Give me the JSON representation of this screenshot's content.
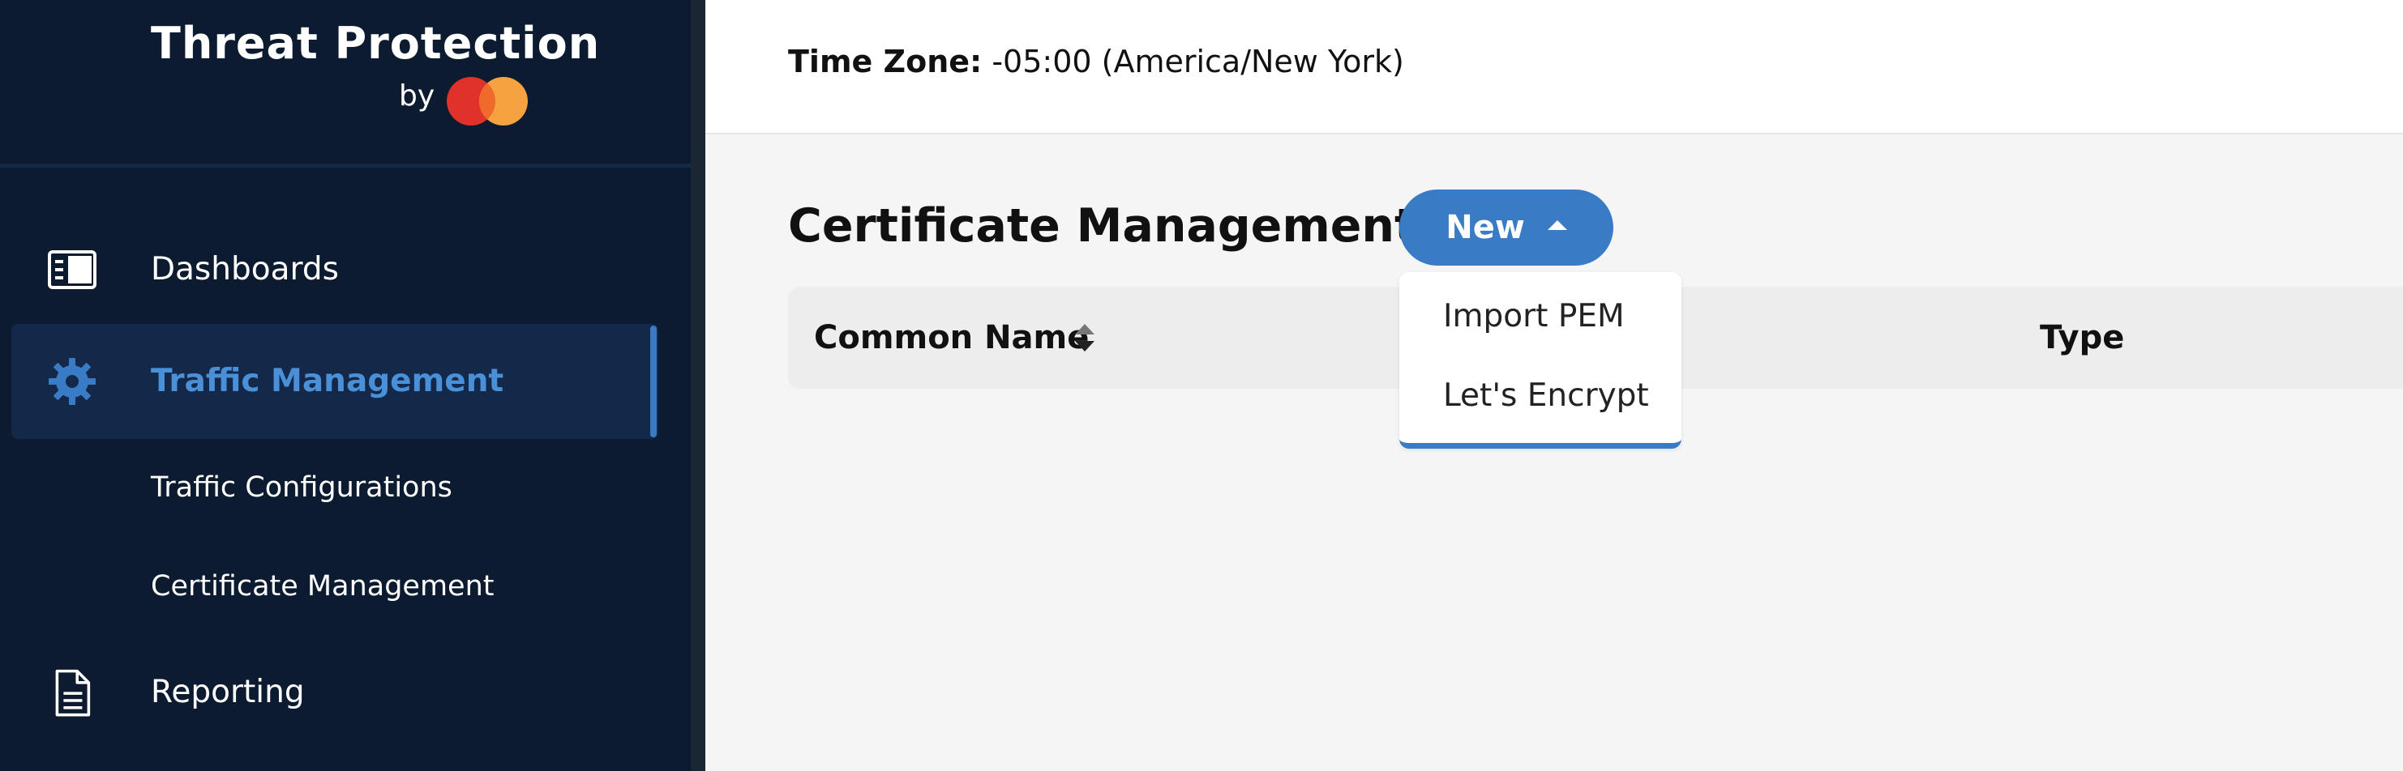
{
  "brand": {
    "title": "Threat Protection",
    "by": "by",
    "logo": "mastercard-logo",
    "logo_colors": {
      "left": "#e0312a",
      "right": "#f4a340"
    }
  },
  "sidebar": {
    "items": [
      {
        "label": "Dashboards",
        "icon": "dashboard-icon",
        "active": false
      },
      {
        "label": "Traffic Management",
        "icon": "gear-icon",
        "active": true
      },
      {
        "label": "Reporting",
        "icon": "document-icon",
        "active": false
      }
    ],
    "subitems": [
      {
        "label": "Traffic Configurations"
      },
      {
        "label": "Certificate Management"
      }
    ]
  },
  "topbar": {
    "timezone_label": "Time Zone:",
    "timezone_value": "-05:00 (America/New York)"
  },
  "main": {
    "title": "Certificate Management",
    "new_button": {
      "label": "New",
      "icon": "caret-up-icon"
    },
    "dropdown": {
      "items": [
        "Import PEM",
        "Let's Encrypt"
      ]
    },
    "table": {
      "columns": [
        "Common Name",
        "Type"
      ]
    }
  },
  "colors": {
    "sidebar_bg": "#0c1b2f",
    "active_bg": "#14294a",
    "accent": "#3a7bc6",
    "active_text": "#4a90d9",
    "page_bg": "#f5f5f5"
  }
}
